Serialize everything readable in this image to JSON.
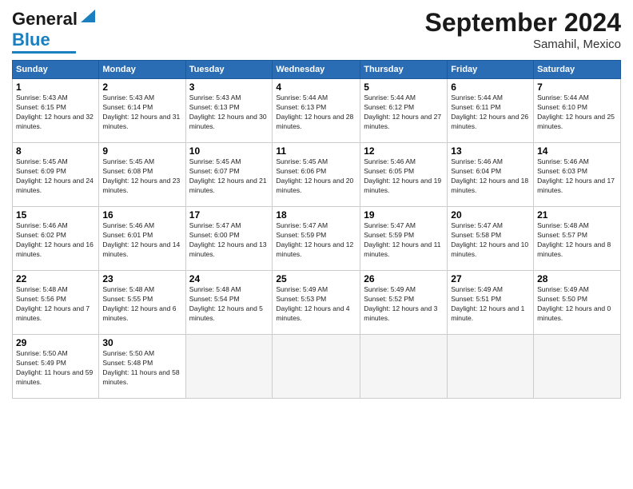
{
  "header": {
    "logo_general": "General",
    "logo_blue": "Blue",
    "month_title": "September 2024",
    "location": "Samahil, Mexico"
  },
  "days_of_week": [
    "Sunday",
    "Monday",
    "Tuesday",
    "Wednesday",
    "Thursday",
    "Friday",
    "Saturday"
  ],
  "weeks": [
    [
      {
        "day": "1",
        "sunrise": "5:43 AM",
        "sunset": "6:15 PM",
        "daylight": "12 hours and 32 minutes."
      },
      {
        "day": "2",
        "sunrise": "5:43 AM",
        "sunset": "6:14 PM",
        "daylight": "12 hours and 31 minutes."
      },
      {
        "day": "3",
        "sunrise": "5:43 AM",
        "sunset": "6:13 PM",
        "daylight": "12 hours and 30 minutes."
      },
      {
        "day": "4",
        "sunrise": "5:44 AM",
        "sunset": "6:13 PM",
        "daylight": "12 hours and 28 minutes."
      },
      {
        "day": "5",
        "sunrise": "5:44 AM",
        "sunset": "6:12 PM",
        "daylight": "12 hours and 27 minutes."
      },
      {
        "day": "6",
        "sunrise": "5:44 AM",
        "sunset": "6:11 PM",
        "daylight": "12 hours and 26 minutes."
      },
      {
        "day": "7",
        "sunrise": "5:44 AM",
        "sunset": "6:10 PM",
        "daylight": "12 hours and 25 minutes."
      }
    ],
    [
      {
        "day": "8",
        "sunrise": "5:45 AM",
        "sunset": "6:09 PM",
        "daylight": "12 hours and 24 minutes."
      },
      {
        "day": "9",
        "sunrise": "5:45 AM",
        "sunset": "6:08 PM",
        "daylight": "12 hours and 23 minutes."
      },
      {
        "day": "10",
        "sunrise": "5:45 AM",
        "sunset": "6:07 PM",
        "daylight": "12 hours and 21 minutes."
      },
      {
        "day": "11",
        "sunrise": "5:45 AM",
        "sunset": "6:06 PM",
        "daylight": "12 hours and 20 minutes."
      },
      {
        "day": "12",
        "sunrise": "5:46 AM",
        "sunset": "6:05 PM",
        "daylight": "12 hours and 19 minutes."
      },
      {
        "day": "13",
        "sunrise": "5:46 AM",
        "sunset": "6:04 PM",
        "daylight": "12 hours and 18 minutes."
      },
      {
        "day": "14",
        "sunrise": "5:46 AM",
        "sunset": "6:03 PM",
        "daylight": "12 hours and 17 minutes."
      }
    ],
    [
      {
        "day": "15",
        "sunrise": "5:46 AM",
        "sunset": "6:02 PM",
        "daylight": "12 hours and 16 minutes."
      },
      {
        "day": "16",
        "sunrise": "5:46 AM",
        "sunset": "6:01 PM",
        "daylight": "12 hours and 14 minutes."
      },
      {
        "day": "17",
        "sunrise": "5:47 AM",
        "sunset": "6:00 PM",
        "daylight": "12 hours and 13 minutes."
      },
      {
        "day": "18",
        "sunrise": "5:47 AM",
        "sunset": "5:59 PM",
        "daylight": "12 hours and 12 minutes."
      },
      {
        "day": "19",
        "sunrise": "5:47 AM",
        "sunset": "5:59 PM",
        "daylight": "12 hours and 11 minutes."
      },
      {
        "day": "20",
        "sunrise": "5:47 AM",
        "sunset": "5:58 PM",
        "daylight": "12 hours and 10 minutes."
      },
      {
        "day": "21",
        "sunrise": "5:48 AM",
        "sunset": "5:57 PM",
        "daylight": "12 hours and 8 minutes."
      }
    ],
    [
      {
        "day": "22",
        "sunrise": "5:48 AM",
        "sunset": "5:56 PM",
        "daylight": "12 hours and 7 minutes."
      },
      {
        "day": "23",
        "sunrise": "5:48 AM",
        "sunset": "5:55 PM",
        "daylight": "12 hours and 6 minutes."
      },
      {
        "day": "24",
        "sunrise": "5:48 AM",
        "sunset": "5:54 PM",
        "daylight": "12 hours and 5 minutes."
      },
      {
        "day": "25",
        "sunrise": "5:49 AM",
        "sunset": "5:53 PM",
        "daylight": "12 hours and 4 minutes."
      },
      {
        "day": "26",
        "sunrise": "5:49 AM",
        "sunset": "5:52 PM",
        "daylight": "12 hours and 3 minutes."
      },
      {
        "day": "27",
        "sunrise": "5:49 AM",
        "sunset": "5:51 PM",
        "daylight": "12 hours and 1 minute."
      },
      {
        "day": "28",
        "sunrise": "5:49 AM",
        "sunset": "5:50 PM",
        "daylight": "12 hours and 0 minutes."
      }
    ],
    [
      {
        "day": "29",
        "sunrise": "5:50 AM",
        "sunset": "5:49 PM",
        "daylight": "11 hours and 59 minutes."
      },
      {
        "day": "30",
        "sunrise": "5:50 AM",
        "sunset": "5:48 PM",
        "daylight": "11 hours and 58 minutes."
      },
      null,
      null,
      null,
      null,
      null
    ]
  ]
}
